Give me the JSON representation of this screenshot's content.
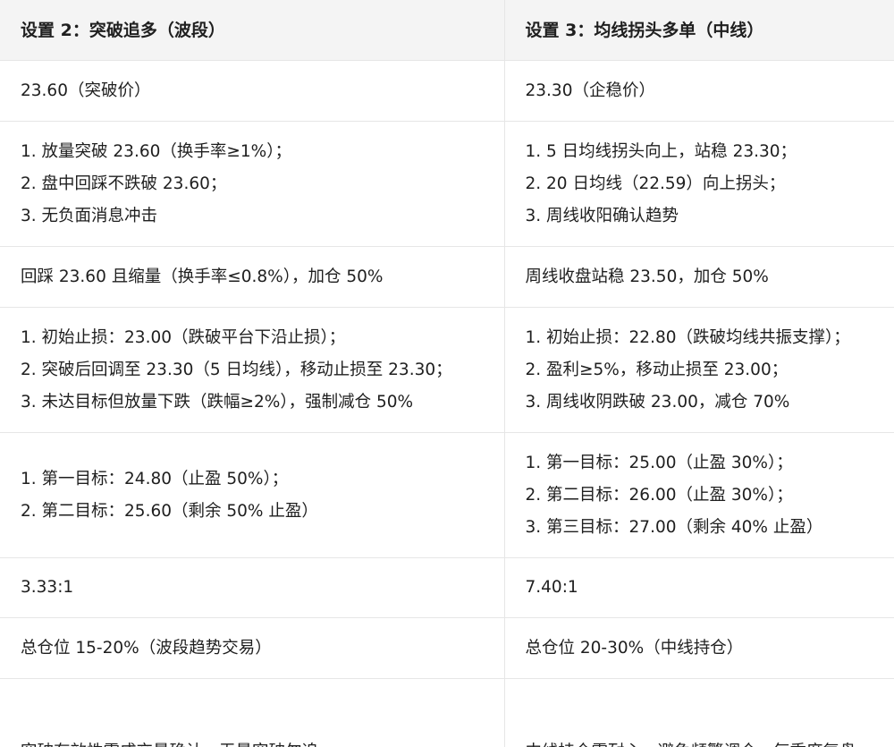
{
  "table": {
    "headers": [
      "设置 2：突破追多（波段）",
      "设置 3：均线拐头多单（中线）"
    ],
    "rows": [
      {
        "col1": [
          "23.60（突破价）"
        ],
        "col2": [
          "23.30（企稳价）"
        ]
      },
      {
        "col1": [
          "1. 放量突破 23.60（换手率≥1%）；",
          "2. 盘中回踩不跌破 23.60；",
          "3. 无负面消息冲击"
        ],
        "col2": [
          "1. 5 日均线拐头向上，站稳 23.30；",
          "2. 20 日均线（22.59）向上拐头；",
          "3. 周线收阳确认趋势"
        ]
      },
      {
        "col1": [
          "回踩 23.60 且缩量（换手率≤0.8%），加仓 50%"
        ],
        "col2": [
          "周线收盘站稳 23.50，加仓 50%"
        ]
      },
      {
        "col1": [
          "1. 初始止损：23.00（跌破平台下沿止损）；",
          "2. 突破后回调至 23.30（5 日均线），移动止损至 23.30；",
          "3. 未达目标但放量下跌（跌幅≥2%），强制减仓 50%"
        ],
        "col2": [
          "1. 初始止损：22.80（跌破均线共振支撑）；",
          "2. 盈利≥5%，移动止损至 23.00；",
          "3. 周线收阴跌破 23.00，减仓 70%"
        ]
      },
      {
        "col1": [
          "1. 第一目标：24.80（止盈 50%）；",
          "2. 第二目标：25.60（剩余 50% 止盈）"
        ],
        "col2": [
          "1. 第一目标：25.00（止盈 30%）；",
          "2. 第二目标：26.00（止盈 30%）；",
          "3. 第三目标：27.00（剩余 40% 止盈）"
        ]
      },
      {
        "col1": [
          "3.33:1"
        ],
        "col2": [
          "7.40:1"
        ]
      },
      {
        "col1": [
          "总仓位 15-20%（波段趋势交易）"
        ],
        "col2": [
          "总仓位 20-30%（中线持仓）"
        ]
      },
      {
        "col1": [
          "突破有效性需成交量确认，无量突破勿追"
        ],
        "col2": [
          "中线持仓需耐心，避免频繁调仓，每季度复盘"
        ]
      }
    ]
  }
}
